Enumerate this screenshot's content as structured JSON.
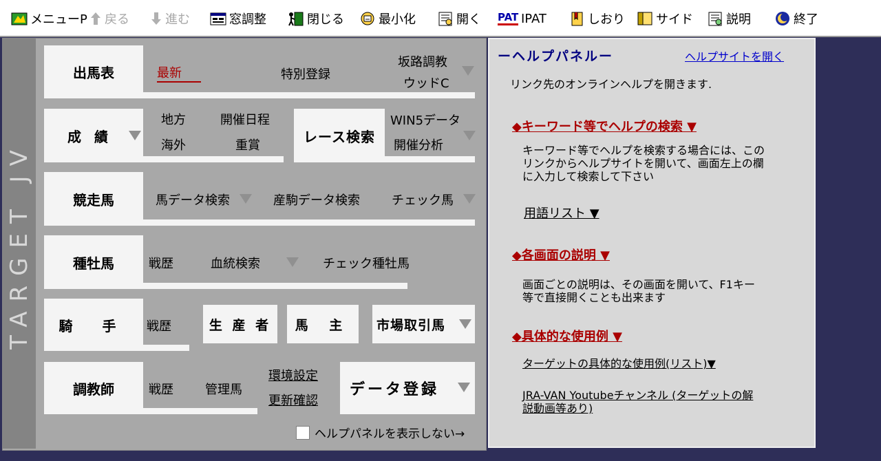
{
  "toolbar": {
    "menu": "メニューP",
    "back": "戻る",
    "forward": "進む",
    "window_adjust": "窓調整",
    "close": "閉じる",
    "minimize": "最小化",
    "open": "開く",
    "ipat": "IPAT",
    "pat_logo": "PAT",
    "bookmark": "しおり",
    "side": "サイド",
    "explain": "説明",
    "exit": "終了"
  },
  "sidebar": {
    "label": "TARGET JV"
  },
  "rows": {
    "syutsuba": {
      "label": "出馬表",
      "latest": "最新",
      "special": "特別登録",
      "slope": "坂路調教",
      "wood": "ウッドC"
    },
    "seiseki": {
      "label": "成 績",
      "chiho": "地方",
      "kaisai": "開催日程",
      "kaigai": "海外",
      "jusho": "重賞",
      "race_search": "レース検索",
      "win5": "WIN5データ",
      "analysis": "開催分析"
    },
    "kyosoba": {
      "label": "競走馬",
      "uma_search": "馬データ検索",
      "sanku": "産駒データ検索",
      "check": "チェック馬"
    },
    "shubaba": {
      "label": "種牡馬",
      "senreki": "戦歴",
      "ketto": "血統検索",
      "check": "チェック種牡馬"
    },
    "kishu": {
      "label": "騎 手",
      "senreki": "戦歴",
      "seisansha": "生 産 者",
      "umanushi": "馬 主",
      "market": "市場取引馬"
    },
    "chokyoshi": {
      "label": "調教師",
      "senreki": "戦歴",
      "kanriba": "管理馬",
      "env": "環境設定",
      "update": "更新確認",
      "data_reg": "データ登録"
    }
  },
  "hide_help": "ヘルプパネルを表示しない→",
  "help": {
    "title": "ーヘルプパネルー",
    "site_link": "ヘルプサイトを開く",
    "intro": "リンク先のオンラインヘルプを開きます.",
    "keyword_head": "◆キーワード等でヘルプの検索 ▼",
    "keyword_l1": "キーワード等でヘルプを検索する場合には、この",
    "keyword_l2": "リンクからヘルプサイトを開いて、画面左上の欄",
    "keyword_l3": "に入力して検索して下さい",
    "terms": "用語リスト ▼",
    "screens_head": "◆各画面の説明 ▼",
    "screens_l1": "画面ごとの説明は、その画面を開いて、F1キー",
    "screens_l2": "等で直接開くことも出来ます",
    "examples_head": "◆具体的な使用例 ▼",
    "examples_link": "ターゲットの具体的な使用例(リスト)▼",
    "youtube_l1": "JRA-VAN Youtubeチャンネル (ターゲットの解",
    "youtube_l2": "説動画等あり)"
  },
  "colors": {
    "accent_red": "#aa0000",
    "link_blue": "#0000cc",
    "panel_gray": "#a8a8a8",
    "background": "#2e2e58"
  }
}
